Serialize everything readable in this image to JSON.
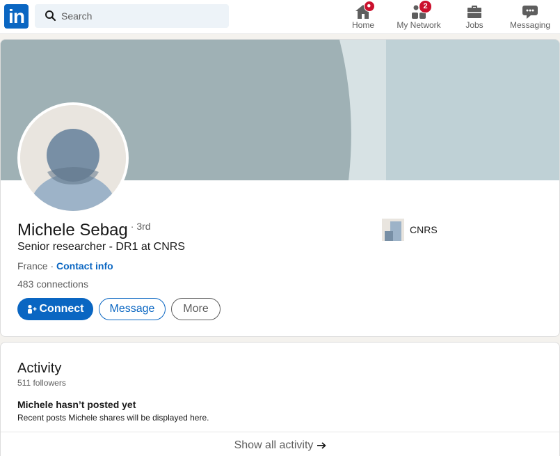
{
  "nav": {
    "logo_text": "in",
    "search_placeholder": "Search",
    "items": [
      {
        "label": "Home",
        "icon": "home-icon",
        "badge": ""
      },
      {
        "label": "My Network",
        "icon": "network-icon",
        "badge": "2"
      },
      {
        "label": "Jobs",
        "icon": "briefcase-icon",
        "badge": ""
      },
      {
        "label": "Messaging",
        "icon": "message-icon",
        "badge": ""
      }
    ]
  },
  "profile": {
    "name": "Michele Sebag",
    "degree": "· 3rd",
    "headline": "Senior researcher - DR1 at CNRS",
    "location": "France · ",
    "contact_info": "Contact info",
    "connections_count": "483",
    "connections_label": " connections",
    "organization": "CNRS",
    "buttons": {
      "connect": "Connect",
      "message": "Message",
      "more": "More"
    }
  },
  "activity": {
    "title": "Activity",
    "followers": "511 followers",
    "empty_title": "Michele hasn’t posted yet",
    "empty_subtitle": "Recent posts Michele shares will be displayed here.",
    "show_all": "Show all activity"
  },
  "colors": {
    "brand": "#0a66c2",
    "badge": "#cb112d",
    "banner_dark": "#9fb1b5",
    "banner_light": "#bfd1d6"
  }
}
